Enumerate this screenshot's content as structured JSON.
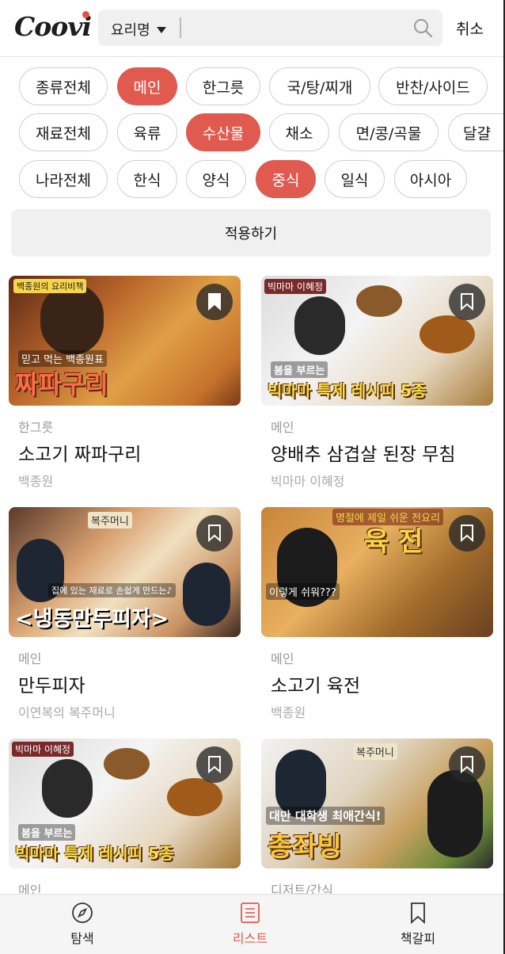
{
  "header": {
    "logo": "Coovi",
    "search_selector": "요리명",
    "search_value": "",
    "cancel_label": "취소"
  },
  "filters": {
    "type_row": [
      {
        "label": "종류전체",
        "active": false
      },
      {
        "label": "메인",
        "active": true
      },
      {
        "label": "한그릇",
        "active": false
      },
      {
        "label": "국/탕/찌개",
        "active": false
      },
      {
        "label": "반찬/사이드",
        "active": false
      }
    ],
    "ingredient_row": [
      {
        "label": "재료전체",
        "active": false
      },
      {
        "label": "육류",
        "active": false
      },
      {
        "label": "수산물",
        "active": true
      },
      {
        "label": "채소",
        "active": false
      },
      {
        "label": "면/콩/곡물",
        "active": false
      },
      {
        "label": "달걀",
        "active": false
      }
    ],
    "country_row": [
      {
        "label": "나라전체",
        "active": false
      },
      {
        "label": "한식",
        "active": false
      },
      {
        "label": "양식",
        "active": false
      },
      {
        "label": "중식",
        "active": true
      },
      {
        "label": "일식",
        "active": false
      },
      {
        "label": "아시아",
        "active": false
      }
    ],
    "apply_label": "적용하기"
  },
  "recipes": [
    {
      "category": "한그릇",
      "title": "소고기 짜파구리",
      "author": "백종원",
      "thumb_caption": "짜파구리",
      "thumb_sub": "믿고 먹는 백종원표",
      "thumb_badge": "백종원의 요리비책"
    },
    {
      "category": "메인",
      "title": "양배추 삼겹살 된장 무침",
      "author": "빅마마 이혜정",
      "thumb_caption": "빅마마 특제 레시피 5종",
      "thumb_sub": "봄을 부르는",
      "thumb_badge": "빅마마 이혜정"
    },
    {
      "category": "메인",
      "title": "만두피자",
      "author": "이연복의 복주머니",
      "thumb_caption": "<냉동만두피자>",
      "thumb_sub": "집에 있는 재료로 손쉽게 만드는♪",
      "thumb_badge": "복주머니"
    },
    {
      "category": "메인",
      "title": "소고기 육전",
      "author": "백종원",
      "thumb_caption": "육 전",
      "thumb_sub": "이렇게 쉬워???",
      "thumb_badge": "명절에 제일 쉬운 전요리"
    },
    {
      "category": "메인",
      "title": "",
      "author": "",
      "thumb_caption": "빅마마 특제 레시피 5종",
      "thumb_sub": "봄을 부르는",
      "thumb_badge": "빅마마 이혜정"
    },
    {
      "category": "디저트/간식",
      "title": "",
      "author": "",
      "thumb_caption": "총좌빙",
      "thumb_sub": "대만 대학생 최애간식!",
      "thumb_badge": "복주머니"
    }
  ],
  "bottom_nav": [
    {
      "label": "탐색",
      "icon": "compass-icon",
      "active": false
    },
    {
      "label": "리스트",
      "icon": "list-icon",
      "active": true
    },
    {
      "label": "책갈피",
      "icon": "bookmark-icon",
      "active": false
    }
  ],
  "colors": {
    "accent": "#e05a4f",
    "chip_border": "#cfcfcf",
    "surface": "#f0f0f0"
  }
}
